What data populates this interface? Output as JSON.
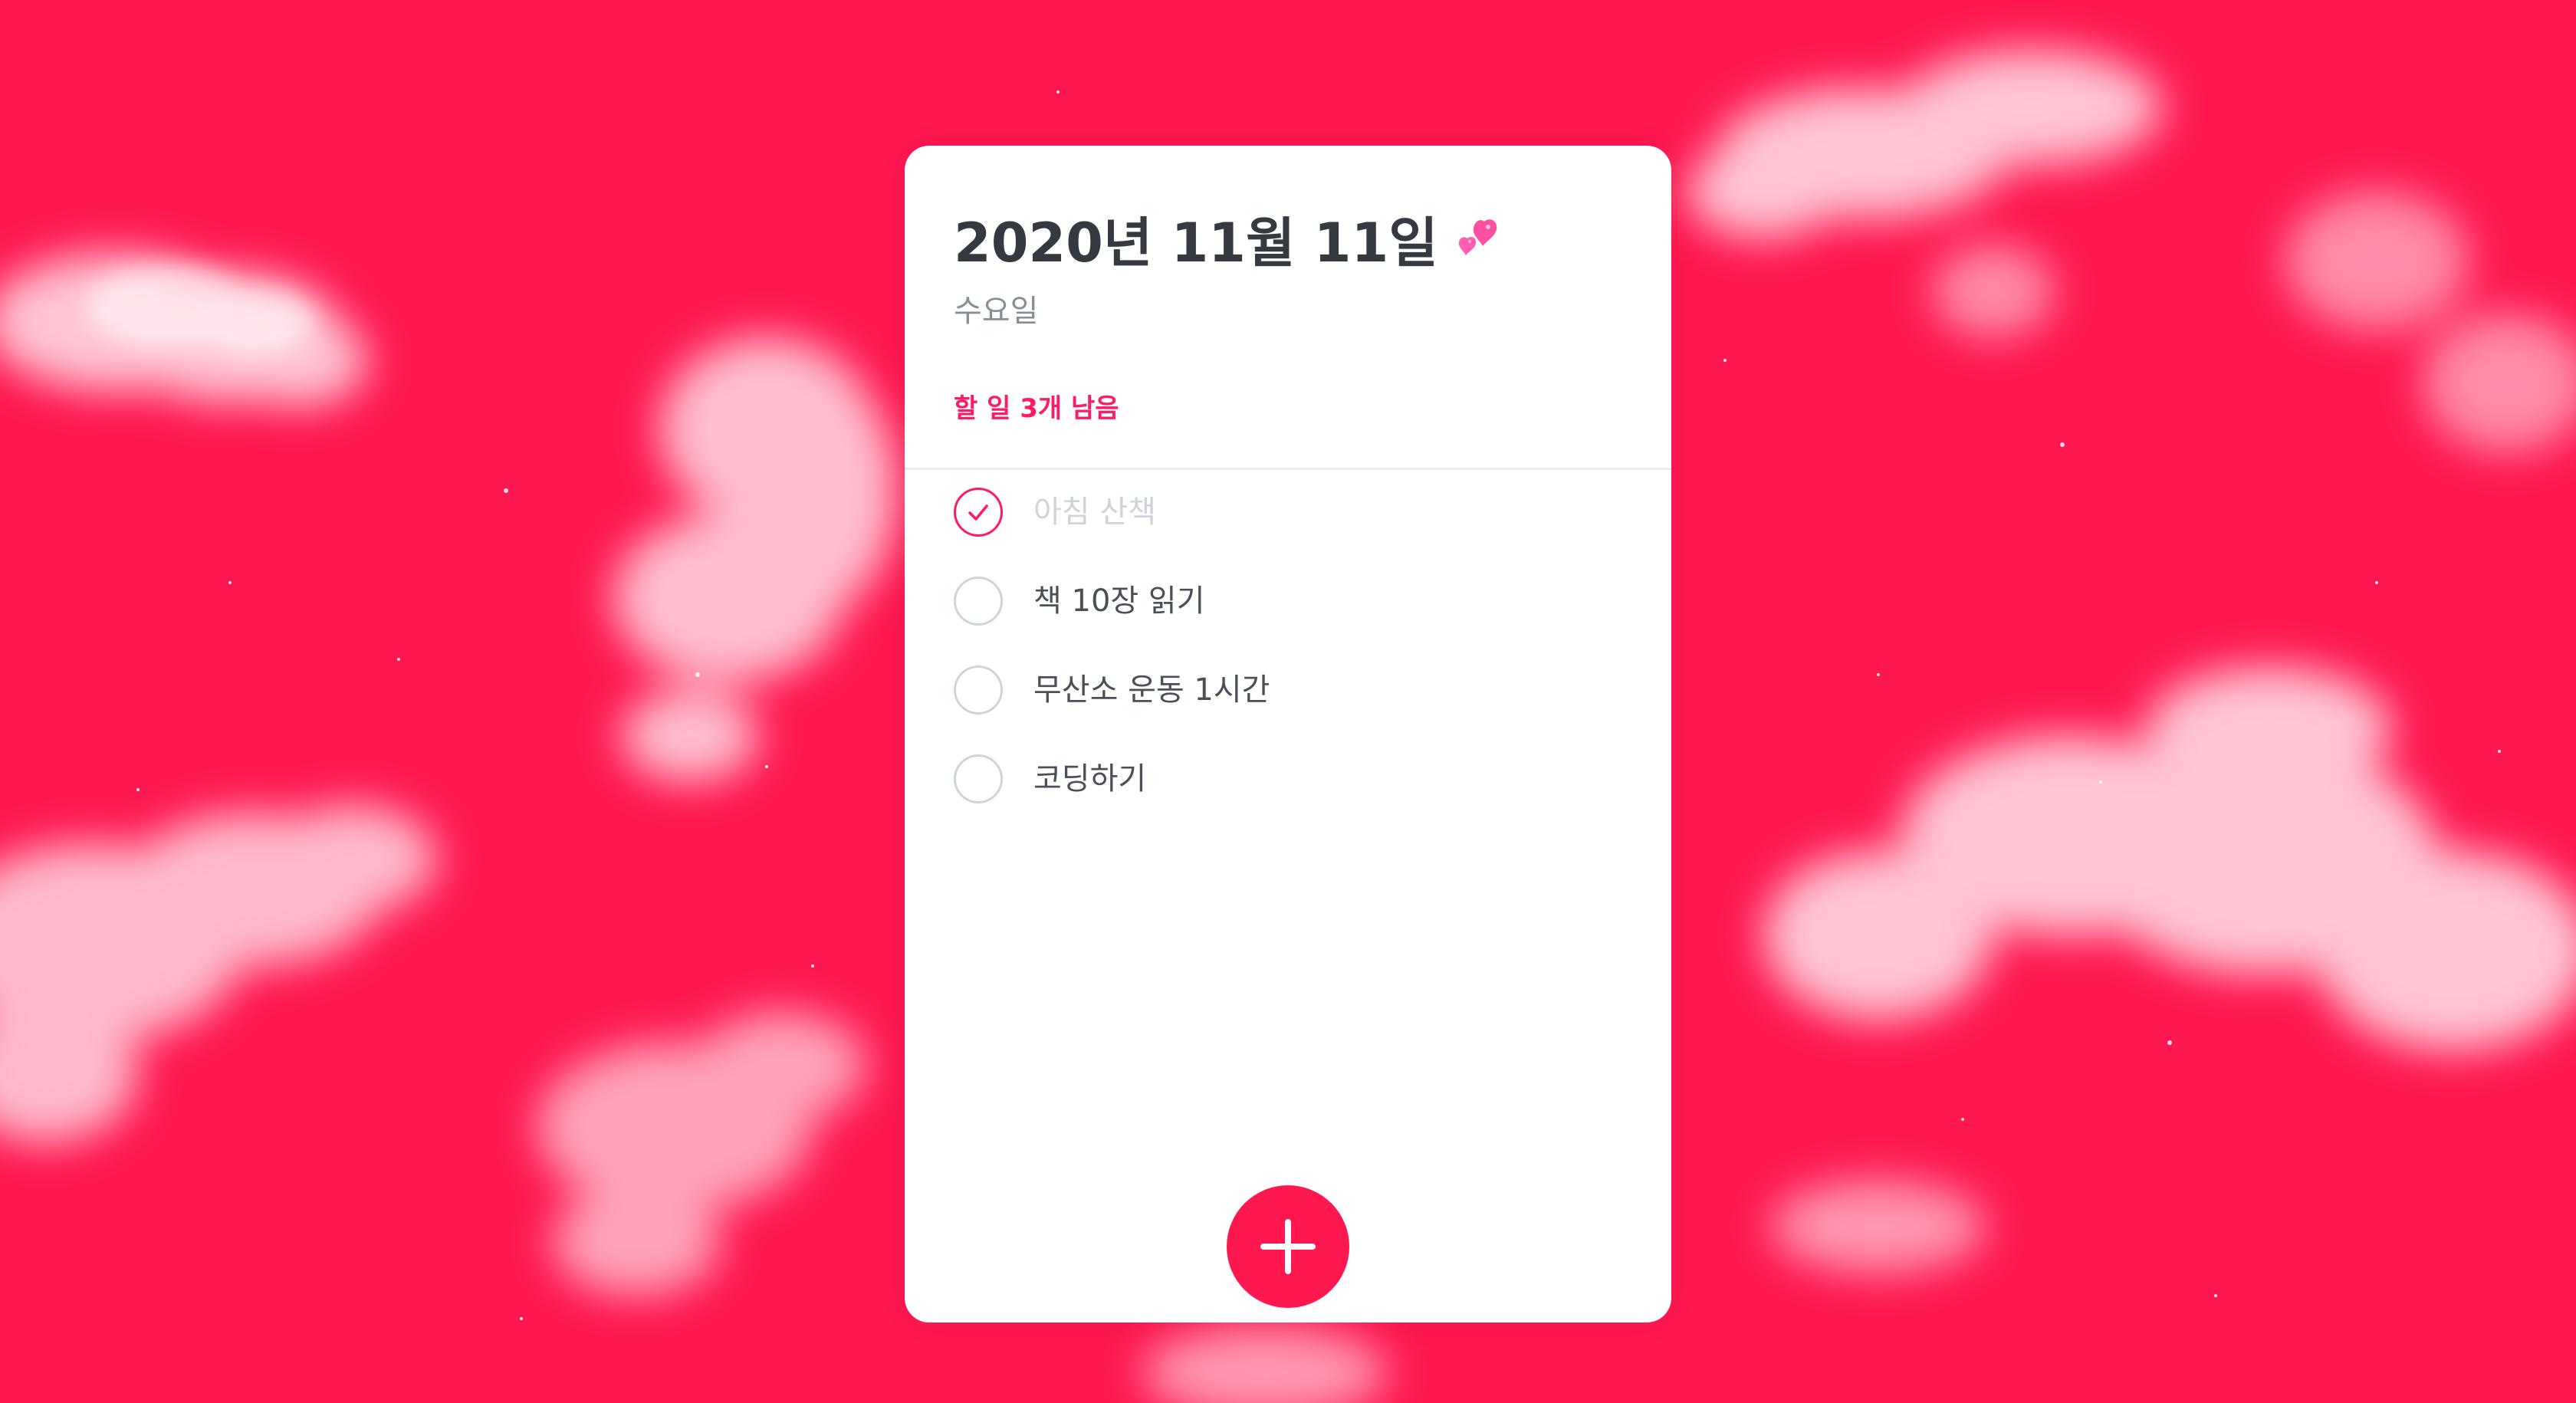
{
  "background": {
    "color": "#ff1750",
    "decoration": "pink-sky-with-clouds"
  },
  "header": {
    "date": "2020년 11월 11일",
    "date_emoji": "two-hearts-icon",
    "day": "수요일",
    "tasks_left": "할 일 3개 남음"
  },
  "todos": [
    {
      "text": "아침 산책",
      "done": true
    },
    {
      "text": "책 10장 읽기",
      "done": false
    },
    {
      "text": "무산소 운동 1시간",
      "done": false
    },
    {
      "text": "코딩하기",
      "done": false
    }
  ],
  "add_button": {
    "icon": "plus-icon",
    "color": "#ff1750"
  },
  "colors": {
    "accent": "#ff1b63",
    "title": "#343a40",
    "subtitle": "#868e96",
    "item_text": "#495057",
    "done_text": "#ced4da"
  }
}
